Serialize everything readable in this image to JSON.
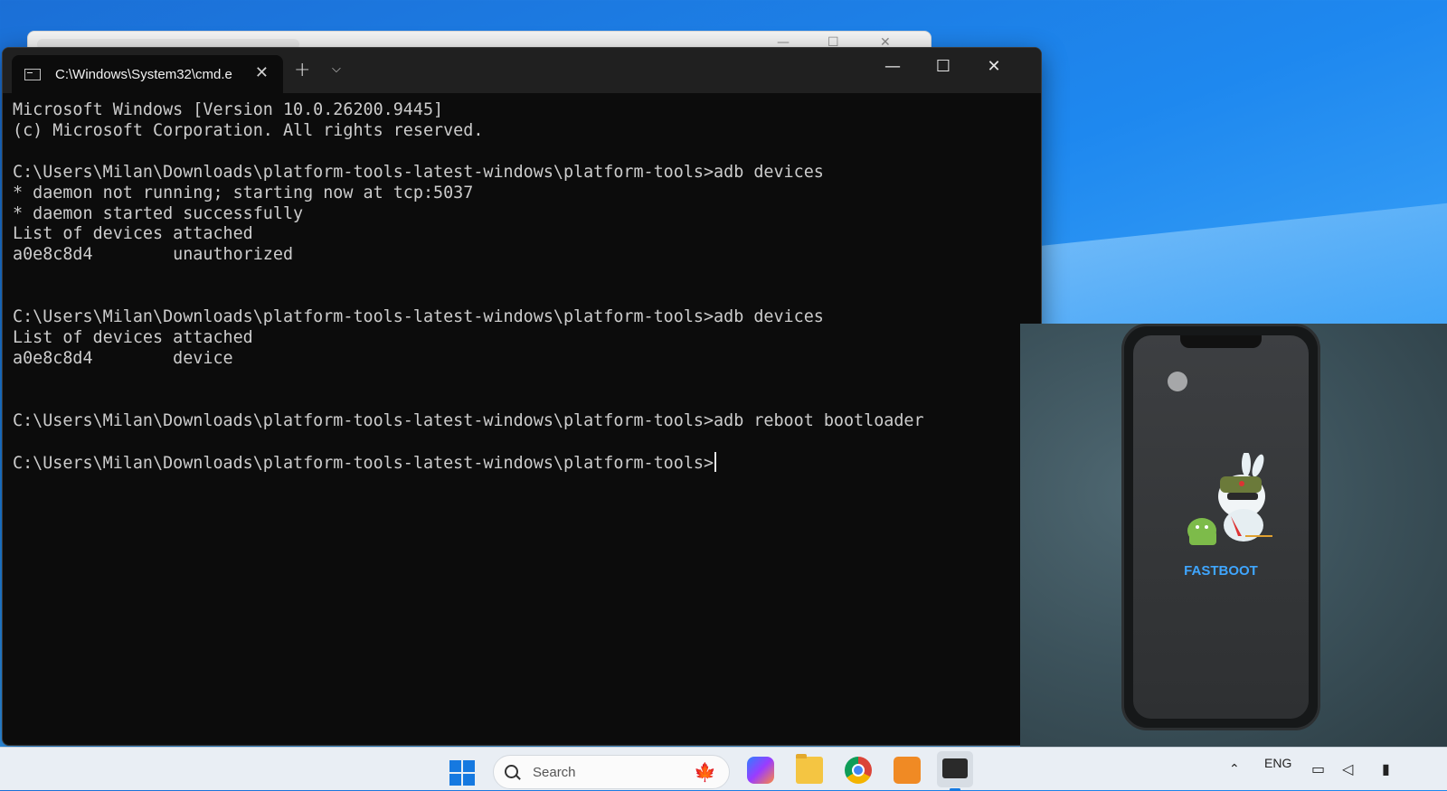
{
  "background_window": {
    "controls": [
      "—",
      "☐",
      "✕"
    ]
  },
  "terminal": {
    "tab_title": "C:\\Windows\\System32\\cmd.e",
    "tab_close": "✕",
    "new_tab": "+",
    "tab_dropdown": "⌵",
    "minimize": "—",
    "maximize": "☐",
    "close": "✕",
    "lines": [
      "Microsoft Windows [Version 10.0.26200.9445]",
      "(c) Microsoft Corporation. All rights reserved.",
      "",
      "C:\\Users\\Milan\\Downloads\\platform-tools-latest-windows\\platform-tools>adb devices",
      "* daemon not running; starting now at tcp:5037",
      "* daemon started successfully",
      "List of devices attached",
      "a0e8c8d4        unauthorized",
      "",
      "",
      "C:\\Users\\Milan\\Downloads\\platform-tools-latest-windows\\platform-tools>adb devices",
      "List of devices attached",
      "a0e8c8d4        device",
      "",
      "",
      "C:\\Users\\Milan\\Downloads\\platform-tools-latest-windows\\platform-tools>adb reboot bootloader",
      "",
      "C:\\Users\\Milan\\Downloads\\platform-tools-latest-windows\\platform-tools>"
    ]
  },
  "phone": {
    "screen_text": "FASTBOOT",
    "mascot": "mi-bunny-fastboot-mascot"
  },
  "taskbar": {
    "search_placeholder": "Search",
    "search_decoration": "🍁",
    "language": "ENG",
    "tray_up": "⌃",
    "tray_icons": [
      "wifi-icon",
      "volume-icon",
      "battery-icon"
    ],
    "apps": [
      "copilot-icon",
      "file-explorer-icon",
      "chrome-icon",
      "store-icon",
      "terminal-icon"
    ]
  },
  "colors": {
    "console_bg": "#0c0c0c",
    "console_text": "#cccccc",
    "fastboot_blue": "#3fa6ff",
    "accent": "#1679e0"
  }
}
